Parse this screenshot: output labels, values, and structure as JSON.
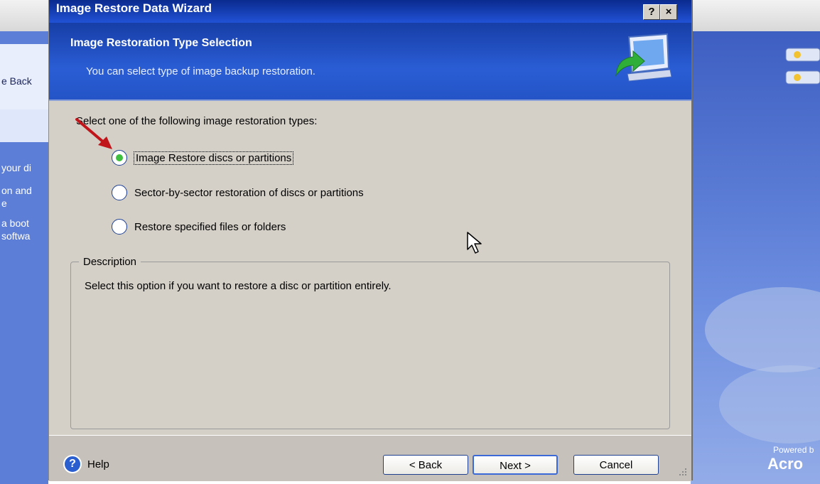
{
  "background": {
    "left_fragments": [
      "e Back",
      "your di",
      "on and",
      "e",
      "a boot",
      "softwa"
    ],
    "powered_text": "Powered b",
    "brand_fragment": "Acro"
  },
  "dialog": {
    "title": "Image Restore Data Wizard",
    "title_buttons": {
      "help": "?",
      "close": "×"
    },
    "header_title": "Image Restoration Type Selection",
    "header_subtitle": "You can select type of image backup restoration.",
    "prompt": "Select one of the following image restoration types:",
    "options": [
      {
        "label": "Image Restore discs or partitions",
        "selected": true
      },
      {
        "label": "Sector-by-sector restoration of discs or partitions",
        "selected": false
      },
      {
        "label": "Restore specified files or folders",
        "selected": false
      }
    ],
    "description_title": "Description",
    "description_text": "Select this option if you want to restore a disc or partition entirely.",
    "help_label": "Help",
    "buttons": {
      "back": "< Back",
      "next": "Next >",
      "cancel": "Cancel"
    }
  },
  "colors": {
    "title_bar": "#0a2a8e",
    "header": "#2a5dd5",
    "selected_radio": "#3fbf3f",
    "annotation_arrow": "#c0161b"
  }
}
